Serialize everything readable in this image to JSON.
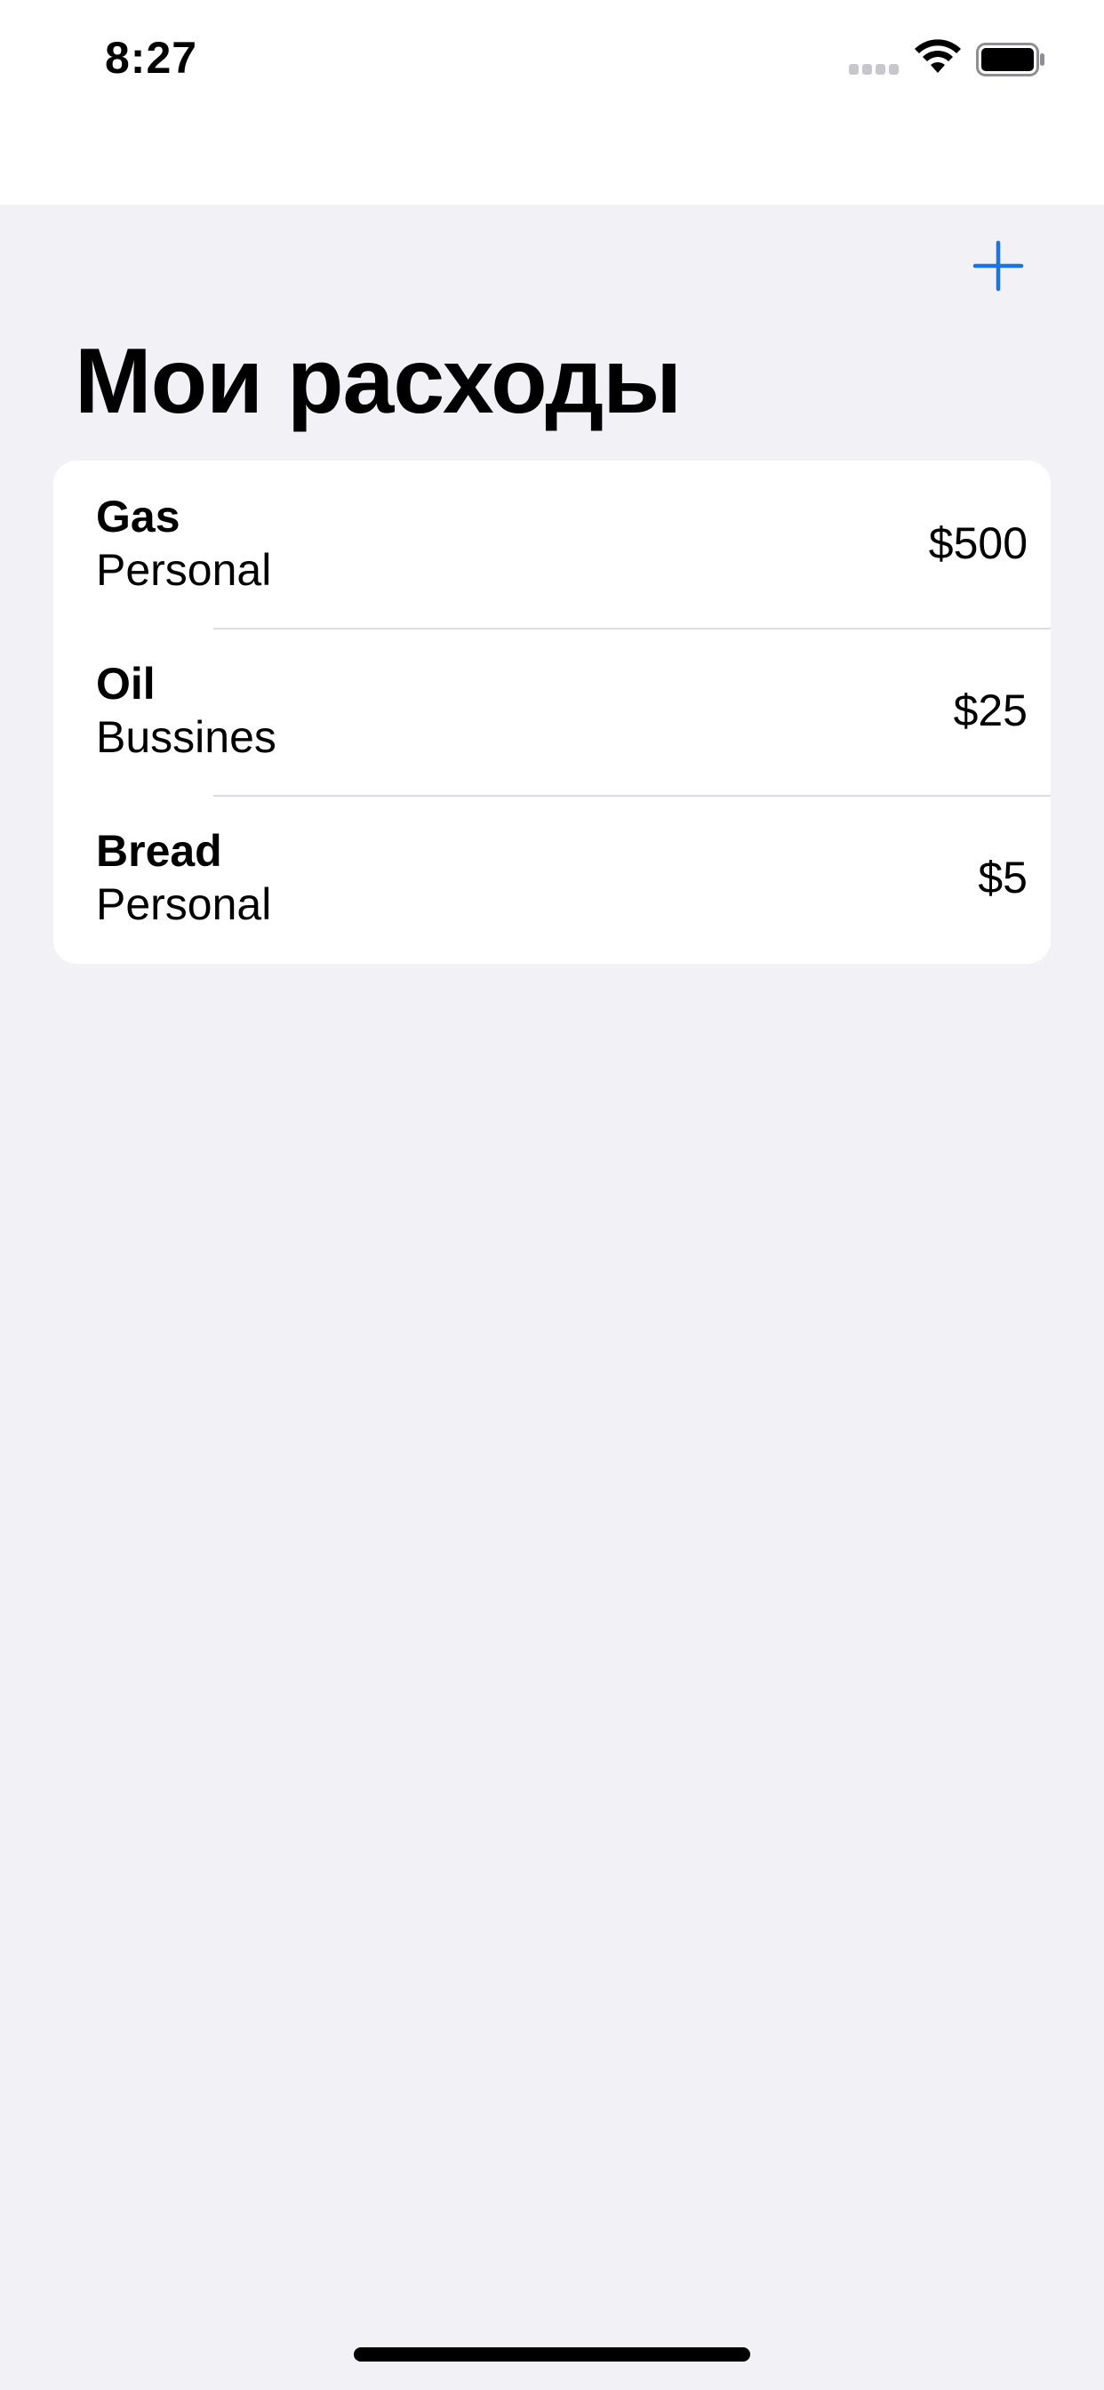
{
  "status_bar": {
    "time": "8:27",
    "icons": [
      "cellular-signal-icon",
      "wifi-icon",
      "battery-icon"
    ]
  },
  "nav": {
    "add_icon": "plus-icon",
    "title": "Мои расходы"
  },
  "expenses": [
    {
      "name": "Gas",
      "type": "Personal",
      "amount": "$500"
    },
    {
      "name": "Oil",
      "type": "Bussines",
      "amount": "$25"
    },
    {
      "name": "Bread",
      "type": "Personal",
      "amount": "$5"
    }
  ],
  "colors": {
    "accent": "#1a73e8",
    "background": "#f1f1f6",
    "card": "#ffffff"
  }
}
